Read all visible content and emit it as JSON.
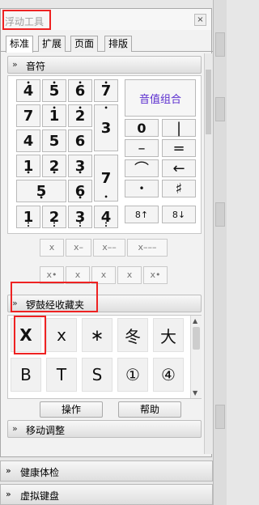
{
  "window": {
    "title": "浮动工具",
    "close_glyph": "×"
  },
  "tabs": [
    "标准",
    "扩展",
    "页面",
    "排版"
  ],
  "notes_group": {
    "label": "音符",
    "chevron": "»"
  },
  "notes": {
    "r1": [
      "4",
      "5",
      "6",
      "7"
    ],
    "r2": [
      "7",
      "1",
      "2",
      "3"
    ],
    "r3": [
      "4",
      "5",
      "6"
    ],
    "r4": [
      "1",
      "2",
      "3"
    ],
    "r5": [
      "5",
      "6",
      "7"
    ],
    "r6": [
      "1",
      "2",
      "3",
      "4"
    ],
    "combo_label": "音值组合",
    "zero": "0",
    "barline": "|",
    "dash": "–",
    "double_dash": "=",
    "tie": "⌒",
    "arrow": "←",
    "dot": "•",
    "sharp": "♯",
    "oct_up": "8↑",
    "oct_down": "8↓",
    "dur_row1": [
      "x",
      "x–",
      "x––",
      "x–––"
    ],
    "dur_row2": [
      "x•",
      "x",
      "x",
      "x",
      "x•"
    ]
  },
  "fav_group": {
    "label": "锣鼓经收藏夹",
    "chevron": "»"
  },
  "favorites": {
    "row1": [
      "X",
      "x",
      "∗",
      "冬",
      "大"
    ],
    "row2": [
      "B",
      "T",
      "S",
      "①",
      "④"
    ]
  },
  "actions": {
    "operate": "操作",
    "help": "帮助"
  },
  "move_group": {
    "label": "移动调整",
    "chevron": "»"
  },
  "bottom": [
    {
      "label": "健康体检",
      "chevron": "»"
    },
    {
      "label": "虚拟键盘",
      "chevron": "»"
    }
  ]
}
